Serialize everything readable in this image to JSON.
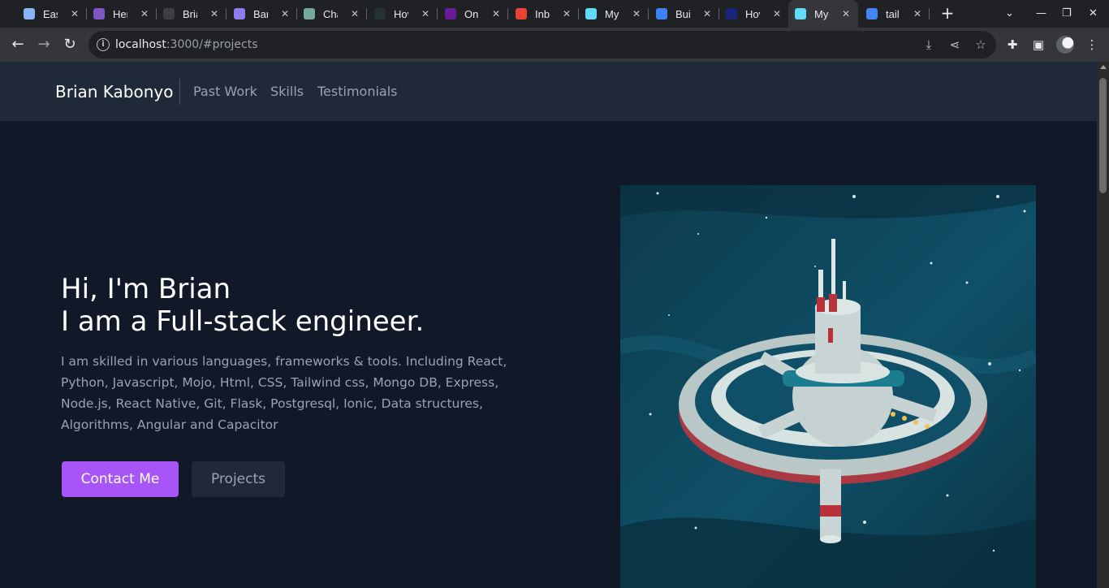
{
  "browser": {
    "tabs": [
      {
        "title": "Eas",
        "favicon_color": "#8ab4f8"
      },
      {
        "title": "Her",
        "favicon_color": "#7e57c2"
      },
      {
        "title": "Bria",
        "favicon_color": "#3c4043"
      },
      {
        "title": "Bar",
        "favicon_color": "#8e7cf0"
      },
      {
        "title": "Cha",
        "favicon_color": "#74aa9c"
      },
      {
        "title": "Hov",
        "favicon_color": "#263238"
      },
      {
        "title": "Onl",
        "favicon_color": "#6a1b9a"
      },
      {
        "title": "Inb",
        "favicon_color": "#ea4335"
      },
      {
        "title": "My",
        "favicon_color": "#61dafb"
      },
      {
        "title": "Bui",
        "favicon_color": "#3b82f6"
      },
      {
        "title": "Hov",
        "favicon_color": "#1a237e"
      },
      {
        "title": "My",
        "favicon_color": "#61dafb",
        "active": true
      },
      {
        "title": "tail",
        "favicon_color": "#4285f4"
      }
    ],
    "url_host": "localhost",
    "url_path": ":3000/#projects"
  },
  "site": {
    "brand": "Brian Kabonyo",
    "nav": [
      "Past Work",
      "Skills",
      "Testimonials"
    ]
  },
  "hero": {
    "heading_line1": "Hi, I'm Brian",
    "heading_line2": "I am a Full-stack engineer.",
    "paragraph": "I am skilled in various languages, frameworks & tools. Including React, Python, Javascript, Mojo, Html, CSS, Tailwind css, Mongo DB, Express, Node.js, React Native, Git, Flask, Postgresql, Ionic, Data structures, Algorithms, Angular and Capacitor",
    "primary_button": "Contact Me",
    "secondary_button": "Projects"
  },
  "colors": {
    "page_bg": "#111827",
    "nav_bg": "#1f2937",
    "accent": "#a855f7"
  },
  "icons": {
    "back": "arrow-left-icon",
    "forward": "arrow-right-icon",
    "reload": "reload-icon",
    "info": "info-icon",
    "install": "install-icon",
    "share": "share-icon",
    "bookmark": "star-icon",
    "extensions": "puzzle-icon",
    "sidepanel": "side-panel-icon",
    "menu": "kebab-menu-icon"
  }
}
